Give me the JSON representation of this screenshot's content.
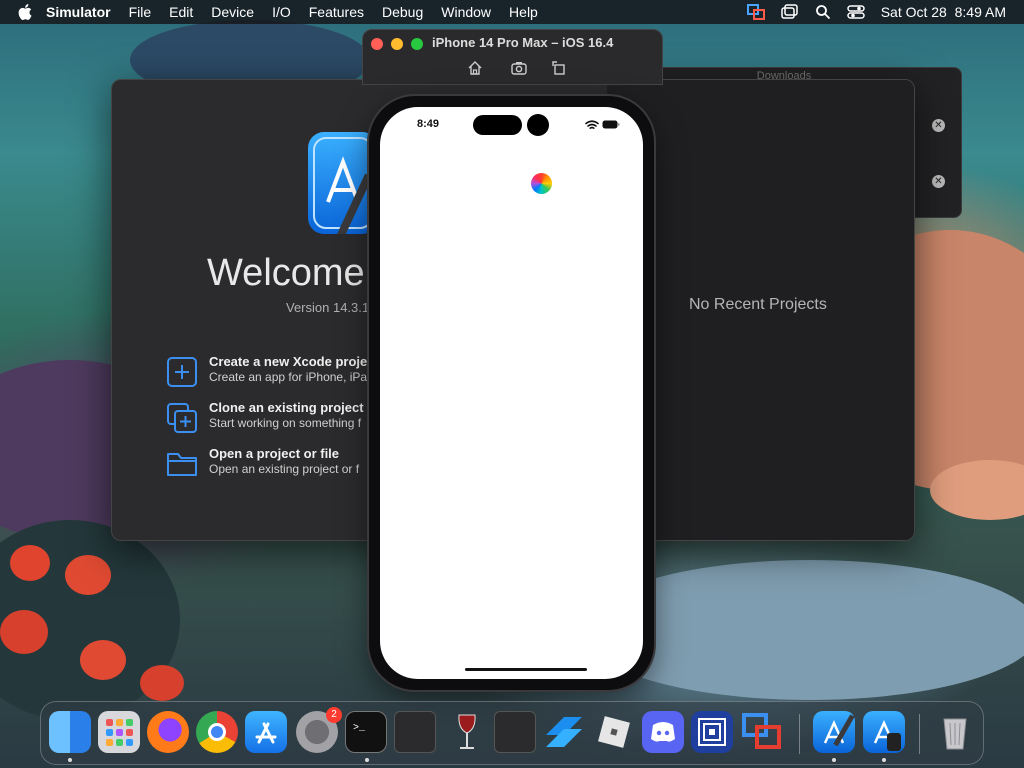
{
  "menubar": {
    "app_name": "Simulator",
    "items": [
      "File",
      "Edit",
      "Device",
      "I/O",
      "Features",
      "Debug",
      "Window",
      "Help"
    ],
    "date_time": "Sat Oct 28  8:49 AM"
  },
  "xcode": {
    "welcome": "Welcome",
    "version": "Version 14.3.1",
    "actions": [
      {
        "title": "Create a new Xcode proje",
        "subtitle": "Create an app for iPhone, iPa",
        "icon": "plus-square-icon"
      },
      {
        "title": "Clone an existing project",
        "subtitle": "Start working on something f",
        "icon": "clone-icon"
      },
      {
        "title": "Open a project or file",
        "subtitle": "Open an existing project or f",
        "icon": "folder-icon"
      }
    ],
    "no_recent": "No Recent Projects"
  },
  "downloads": {
    "title": "Downloads"
  },
  "simulator": {
    "title": "iPhone 14 Pro Max – iOS 16.4",
    "status_time": "8:49"
  },
  "dock": {
    "items": [
      {
        "name": "finder",
        "color": "#2a8cf0"
      },
      {
        "name": "launchpad",
        "color": "#c9c9cf"
      },
      {
        "name": "firefox",
        "color": "#ff7a18"
      },
      {
        "name": "chrome",
        "color": "#e8e8e8"
      },
      {
        "name": "app-store",
        "color": "#1e8cf5"
      },
      {
        "name": "system-settings",
        "color": "#8e8e93",
        "badge": "2"
      },
      {
        "name": "terminal",
        "color": "#1c1c1e"
      },
      {
        "name": "terminal-2",
        "color": "#2b2b2d"
      },
      {
        "name": "wine",
        "color": "#8a1b1b"
      },
      {
        "name": "terminal-3",
        "color": "#2b2b2d"
      },
      {
        "name": "stack-app",
        "color": "#1c8ef0"
      },
      {
        "name": "roblox",
        "color": "#e4e4e4"
      },
      {
        "name": "discord",
        "color": "#5865f2"
      },
      {
        "name": "framed-app",
        "color": "#2a5bd7"
      },
      {
        "name": "remote-app",
        "color": "#d94a3a"
      },
      {
        "name": "xcode",
        "color": "#1c8ef0"
      },
      {
        "name": "simulator-app",
        "color": "#1c8ef0"
      },
      {
        "name": "trash",
        "color": "#b0b0b5"
      }
    ]
  }
}
